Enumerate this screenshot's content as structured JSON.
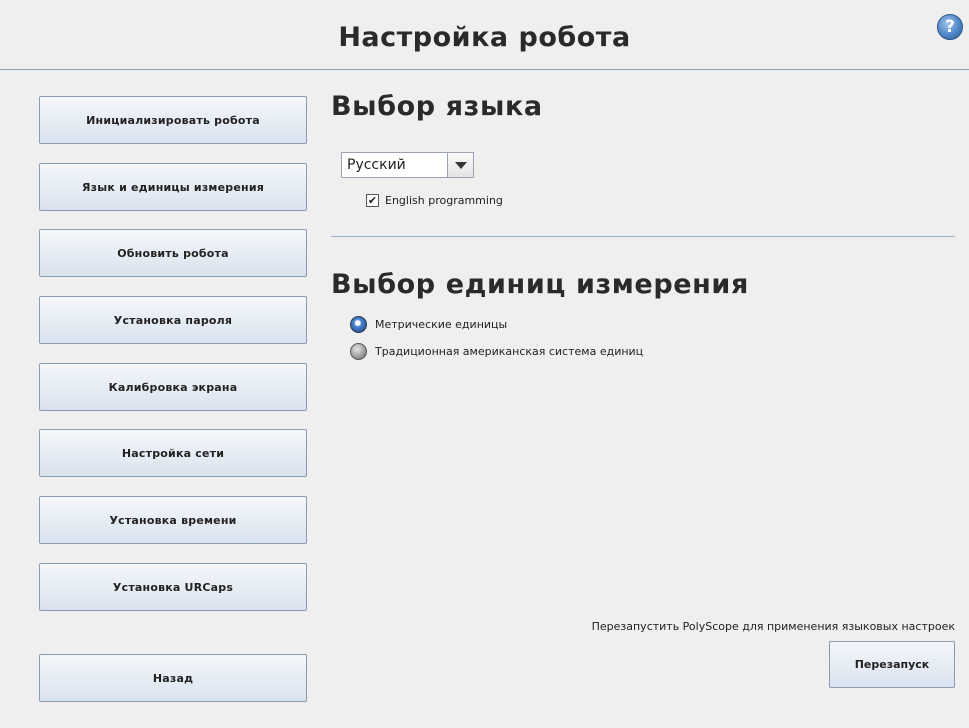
{
  "header": {
    "title": "Настройка робота",
    "help_glyph": "?"
  },
  "sidebar": {
    "items": [
      {
        "label": "Инициализировать робота"
      },
      {
        "label": "Язык и единицы измерения"
      },
      {
        "label": "Обновить робота"
      },
      {
        "label": "Установка пароля"
      },
      {
        "label": "Калибровка экрана"
      },
      {
        "label": "Настройка сети"
      },
      {
        "label": "Установка времени"
      },
      {
        "label": "Установка URCaps"
      }
    ],
    "back_label": "Назад"
  },
  "language": {
    "heading": "Выбор языка",
    "selected": "Русский",
    "english_programming_label": "English programming",
    "english_programming_checked": true,
    "check_glyph": "✔"
  },
  "units": {
    "heading": "Выбор единиц измерения",
    "options": [
      {
        "label": "Метрические единицы",
        "selected": true
      },
      {
        "label": "Традиционная американская система единиц",
        "selected": false
      }
    ]
  },
  "restart": {
    "note": "Перезапустить PolyScope для применения языковых настроек",
    "button_label": "Перезапуск"
  },
  "colors": {
    "accent": "#4f86c6",
    "button_border": "#8b9bb0",
    "background": "#efefef"
  }
}
